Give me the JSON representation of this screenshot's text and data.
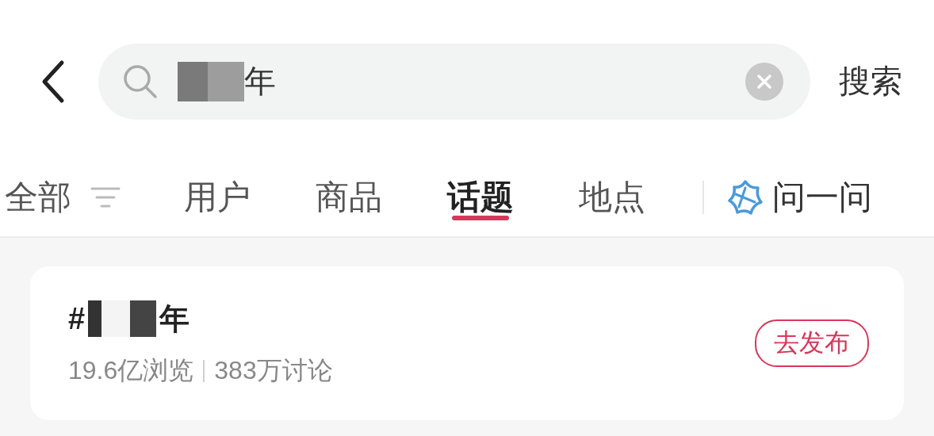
{
  "search": {
    "value": "年",
    "redacted": true
  },
  "search_button": "搜索",
  "tabs": [
    {
      "label": "全部",
      "selected": false,
      "kind": "filter"
    },
    {
      "label": "用户",
      "selected": false,
      "kind": "plain"
    },
    {
      "label": "商品",
      "selected": false,
      "kind": "plain"
    },
    {
      "label": "话题",
      "selected": true,
      "kind": "plain"
    },
    {
      "label": "地点",
      "selected": false,
      "kind": "plain"
    },
    {
      "label": "问一问",
      "selected": false,
      "kind": "ai"
    }
  ],
  "topic": {
    "prefix": "#",
    "redacted": true,
    "title": "年",
    "views": "19.6亿浏览",
    "discussions": "383万讨论",
    "button": "去发布"
  }
}
